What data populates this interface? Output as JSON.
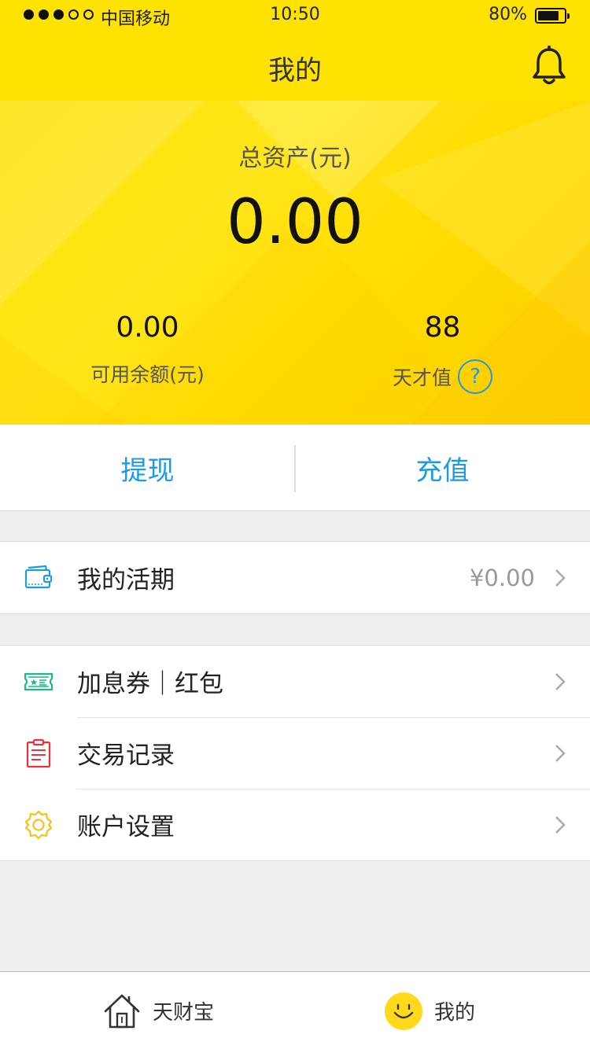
{
  "status_bar": {
    "signal_dots_filled": 3,
    "signal_dots_total": 5,
    "carrier": "中国移动",
    "time": "10:50",
    "battery_text": "80%",
    "battery_level": 0.8
  },
  "nav": {
    "title": "我的",
    "bell_icon": "bell-icon"
  },
  "summary": {
    "total_label": "总资产(元)",
    "total_value": "0.00",
    "available_value": "0.00",
    "available_label": "可用余额(元)",
    "talent_value": "88",
    "talent_label": "天才值",
    "help_glyph": "?"
  },
  "actions": {
    "withdraw": "提现",
    "recharge": "充值"
  },
  "current_account": {
    "icon": "wallet-icon",
    "label": "我的活期",
    "value": "¥0.00"
  },
  "menu": [
    {
      "icon": "coupon-icon",
      "label": "加息券｜红包"
    },
    {
      "icon": "clipboard-icon",
      "label": "交易记录"
    },
    {
      "icon": "gear-icon",
      "label": "账户设置"
    }
  ],
  "tabbar": {
    "home_label": "天财宝",
    "home_icon": "house-icon",
    "mine_label": "我的",
    "mine_icon": "smiley-icon"
  },
  "colors": {
    "brand_yellow": "#ffe300",
    "accent_blue": "#1e9be0",
    "coupon_green": "#1fb88a",
    "record_red": "#e8333a",
    "settings_yellow": "#f4c21a"
  }
}
